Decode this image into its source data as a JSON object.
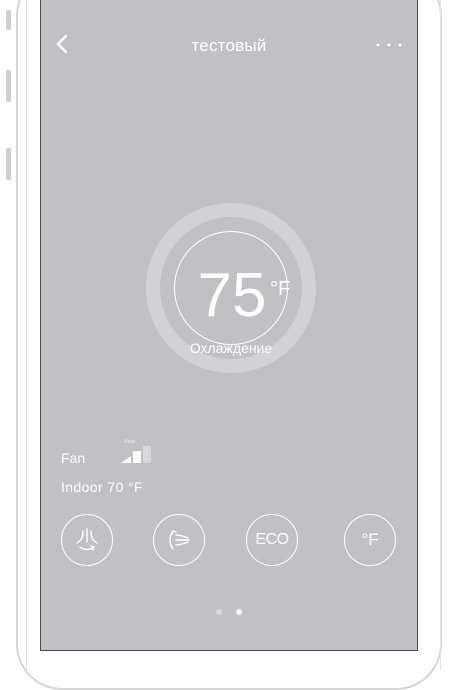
{
  "header": {
    "title": "тестовый"
  },
  "icons": {
    "back": "chevron-left-icon",
    "more": "more-dots-icon",
    "fan": "fan-speed-icon"
  },
  "thermostat": {
    "temperature": "75",
    "unit": "°F",
    "mode": "Охлаждение"
  },
  "status": {
    "fan_label": "Fan",
    "fan_mode": "Auto",
    "fan_level": 0.67,
    "indoor": "Indoor 70 °F"
  },
  "controls": [
    {
      "icon": "vertical-swing-icon"
    },
    {
      "icon": "horizontal-swing-icon"
    },
    {
      "label": "ECO"
    },
    {
      "label": "°F"
    }
  ],
  "pager": {
    "count": 2,
    "active": 2
  },
  "colors": {
    "screen_bg": "#c1c1c3",
    "ring": "#d2d2d4",
    "foreground": "#ffffff"
  }
}
